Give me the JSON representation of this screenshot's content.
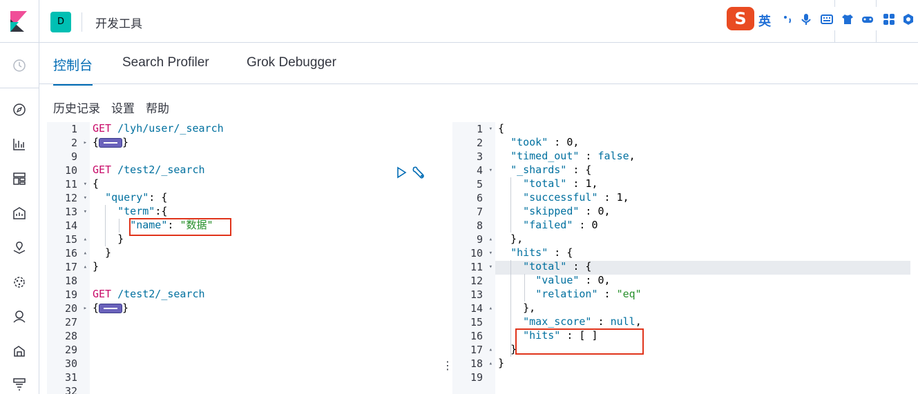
{
  "header": {
    "space_initial": "D",
    "app_title": "开发工具",
    "ime_logo": "S",
    "ime_lang": "英"
  },
  "tabs": [
    {
      "label": "控制台"
    },
    {
      "label": "Search Profiler"
    },
    {
      "label": "Grok Debugger"
    }
  ],
  "toolbar": {
    "history": "历史记录",
    "settings": "设置",
    "help": "帮助"
  },
  "request_editor": {
    "lines": [
      {
        "n": "1",
        "fold": "",
        "tokens": [
          [
            "k-method",
            "GET"
          ],
          [
            "",
            " "
          ],
          [
            "k-url",
            "/lyh/user/_search"
          ]
        ]
      },
      {
        "n": "2",
        "fold": "▸",
        "tokens": [
          [
            "",
            "{"
          ],
          [
            "collapsed",
            ""
          ],
          [
            "",
            "}"
          ]
        ]
      },
      {
        "n": "9",
        "fold": "",
        "tokens": []
      },
      {
        "n": "10",
        "fold": "",
        "tokens": [
          [
            "k-method",
            "GET"
          ],
          [
            "",
            " "
          ],
          [
            "k-url",
            "/test2/_search"
          ]
        ]
      },
      {
        "n": "11",
        "fold": "▾",
        "tokens": [
          [
            "",
            "{"
          ]
        ]
      },
      {
        "n": "12",
        "fold": "▾",
        "tokens": [
          [
            "",
            "  "
          ],
          [
            "k-key",
            "\"query\""
          ],
          [
            "",
            ": {"
          ]
        ]
      },
      {
        "n": "13",
        "fold": "▾",
        "tokens": [
          [
            "",
            "    "
          ],
          [
            "k-key",
            "\"term\""
          ],
          [
            "",
            ":{"
          ]
        ]
      },
      {
        "n": "14",
        "fold": "",
        "tokens": [
          [
            "",
            "      "
          ],
          [
            "k-key",
            "\"name\""
          ],
          [
            "",
            ": "
          ],
          [
            "k-str",
            "\"数据\""
          ]
        ]
      },
      {
        "n": "15",
        "fold": "▴",
        "tokens": [
          [
            "",
            "    }"
          ]
        ]
      },
      {
        "n": "16",
        "fold": "▴",
        "tokens": [
          [
            "",
            "  }"
          ]
        ]
      },
      {
        "n": "17",
        "fold": "▴",
        "tokens": [
          [
            "",
            "}"
          ]
        ]
      },
      {
        "n": "18",
        "fold": "",
        "tokens": []
      },
      {
        "n": "19",
        "fold": "",
        "tokens": [
          [
            "k-method",
            "GET"
          ],
          [
            "",
            " "
          ],
          [
            "k-url",
            "/test2/_search"
          ]
        ]
      },
      {
        "n": "20",
        "fold": "▸",
        "tokens": [
          [
            "",
            "{"
          ],
          [
            "collapsed",
            ""
          ],
          [
            "",
            "}"
          ]
        ]
      },
      {
        "n": "27",
        "fold": "",
        "tokens": []
      },
      {
        "n": "28",
        "fold": "",
        "tokens": []
      },
      {
        "n": "29",
        "fold": "",
        "tokens": []
      },
      {
        "n": "30",
        "fold": "",
        "tokens": []
      },
      {
        "n": "31",
        "fold": "",
        "tokens": []
      },
      {
        "n": "32",
        "fold": "",
        "tokens": []
      }
    ]
  },
  "response_editor": {
    "lines": [
      {
        "n": "1",
        "fold": "▾",
        "tokens": [
          [
            "",
            "{"
          ]
        ]
      },
      {
        "n": "2",
        "fold": "",
        "tokens": [
          [
            "",
            "  "
          ],
          [
            "k-key",
            "\"took\""
          ],
          [
            "",
            " : "
          ],
          [
            "k-num",
            "0"
          ],
          [
            "",
            ","
          ]
        ]
      },
      {
        "n": "3",
        "fold": "",
        "tokens": [
          [
            "",
            "  "
          ],
          [
            "k-key",
            "\"timed_out\""
          ],
          [
            "",
            " : "
          ],
          [
            "k-bool",
            "false"
          ],
          [
            "",
            ","
          ]
        ]
      },
      {
        "n": "4",
        "fold": "▾",
        "tokens": [
          [
            "",
            "  "
          ],
          [
            "k-key",
            "\"_shards\""
          ],
          [
            "",
            " : {"
          ]
        ]
      },
      {
        "n": "5",
        "fold": "",
        "tokens": [
          [
            "",
            "    "
          ],
          [
            "k-key",
            "\"total\""
          ],
          [
            "",
            " : "
          ],
          [
            "k-num",
            "1"
          ],
          [
            "",
            ","
          ]
        ]
      },
      {
        "n": "6",
        "fold": "",
        "tokens": [
          [
            "",
            "    "
          ],
          [
            "k-key",
            "\"successful\""
          ],
          [
            "",
            " : "
          ],
          [
            "k-num",
            "1"
          ],
          [
            "",
            ","
          ]
        ]
      },
      {
        "n": "7",
        "fold": "",
        "tokens": [
          [
            "",
            "    "
          ],
          [
            "k-key",
            "\"skipped\""
          ],
          [
            "",
            " : "
          ],
          [
            "k-num",
            "0"
          ],
          [
            "",
            ","
          ]
        ]
      },
      {
        "n": "8",
        "fold": "",
        "tokens": [
          [
            "",
            "    "
          ],
          [
            "k-key",
            "\"failed\""
          ],
          [
            "",
            " : "
          ],
          [
            "k-num",
            "0"
          ]
        ]
      },
      {
        "n": "9",
        "fold": "▴",
        "tokens": [
          [
            "",
            "  },"
          ]
        ]
      },
      {
        "n": "10",
        "fold": "▾",
        "tokens": [
          [
            "",
            "  "
          ],
          [
            "k-key",
            "\"hits\""
          ],
          [
            "",
            " : {"
          ]
        ]
      },
      {
        "n": "11",
        "fold": "▾",
        "tokens": [
          [
            "",
            "    "
          ],
          [
            "k-key",
            "\"total\""
          ],
          [
            "",
            " : {"
          ]
        ]
      },
      {
        "n": "12",
        "fold": "",
        "tokens": [
          [
            "",
            "      "
          ],
          [
            "k-key",
            "\"value\""
          ],
          [
            "",
            " : "
          ],
          [
            "k-num",
            "0"
          ],
          [
            "",
            ","
          ]
        ]
      },
      {
        "n": "13",
        "fold": "",
        "tokens": [
          [
            "",
            "      "
          ],
          [
            "k-key",
            "\"relation\""
          ],
          [
            "",
            " : "
          ],
          [
            "k-str",
            "\"eq\""
          ]
        ]
      },
      {
        "n": "14",
        "fold": "▴",
        "tokens": [
          [
            "",
            "    },"
          ]
        ]
      },
      {
        "n": "15",
        "fold": "",
        "tokens": [
          [
            "",
            "    "
          ],
          [
            "k-key",
            "\"max_score\""
          ],
          [
            "",
            " : "
          ],
          [
            "k-bool",
            "null"
          ],
          [
            "",
            ","
          ]
        ]
      },
      {
        "n": "16",
        "fold": "",
        "tokens": [
          [
            "",
            "    "
          ],
          [
            "k-key",
            "\"hits\""
          ],
          [
            "",
            " : [ ]"
          ]
        ]
      },
      {
        "n": "17",
        "fold": "▴",
        "tokens": [
          [
            "",
            "  }"
          ]
        ]
      },
      {
        "n": "18",
        "fold": "▴",
        "tokens": [
          [
            "",
            "}"
          ]
        ]
      },
      {
        "n": "19",
        "fold": "",
        "tokens": []
      }
    ]
  },
  "colors": {
    "accent": "#006bb4",
    "highlight_box": "#e0341b",
    "space_badge": "#00bfb3"
  }
}
